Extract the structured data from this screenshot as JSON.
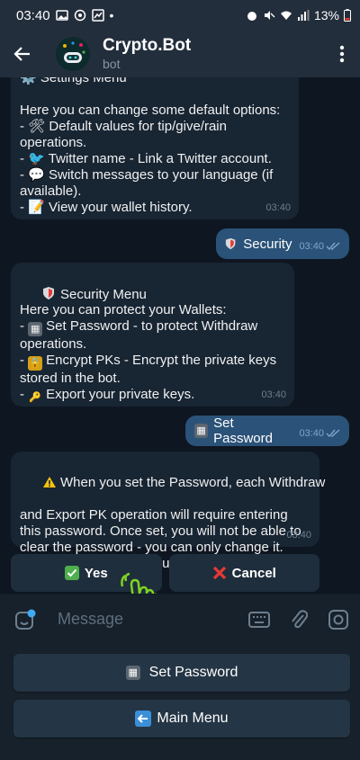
{
  "status_bar": {
    "time": "03:40",
    "dot": "•",
    "battery": "13%"
  },
  "header": {
    "title": "Crypto.Bot",
    "subtitle": "bot"
  },
  "messages": {
    "settings": {
      "partial_title": "⚙️ Settings Menu",
      "lines": [
        "Here you can change some default options:",
        "- 🛠 Default values for tip/give/rain",
        "operations.",
        "- 🐦 Twitter name - Link a Twitter account.",
        "- 💬 Switch messages to your language (if",
        "available).",
        "- 📝 View your wallet history."
      ],
      "time": "03:40"
    },
    "out_security": {
      "text": "Security",
      "time": "03:40"
    },
    "security_menu": {
      "title": "Security Menu",
      "lines": [
        "Here you can protect your Wallets:",
        "Set Password - to protect Withdraw",
        "operations.",
        "Encrypt PKs - Encrypt the private keys",
        "stored in the bot.",
        "Export your private keys."
      ],
      "time": "03:40"
    },
    "out_set_password": {
      "text": "Set Password",
      "time": "03:40"
    },
    "warning": {
      "lines": [
        "When you set the Password, each Withdraw",
        "and Export PK operation will require entering",
        "this password. Once set, you will not be able to",
        "clear the password - you can only change it.",
        "Would you like to continue?"
      ],
      "time": "03:40"
    }
  },
  "inline_keyboard": {
    "yes": "Yes",
    "cancel": "Cancel"
  },
  "input": {
    "placeholder": "Message"
  },
  "reply_keyboard": {
    "set_password": "Set Password",
    "main_menu": "Main Menu"
  },
  "colors": {
    "background": "#0e1621",
    "incoming_bubble": "#182533",
    "outgoing_bubble": "#2b5278",
    "header": "#232e3c",
    "accent_check": "#4fae4e",
    "cancel_red": "#e53935"
  }
}
